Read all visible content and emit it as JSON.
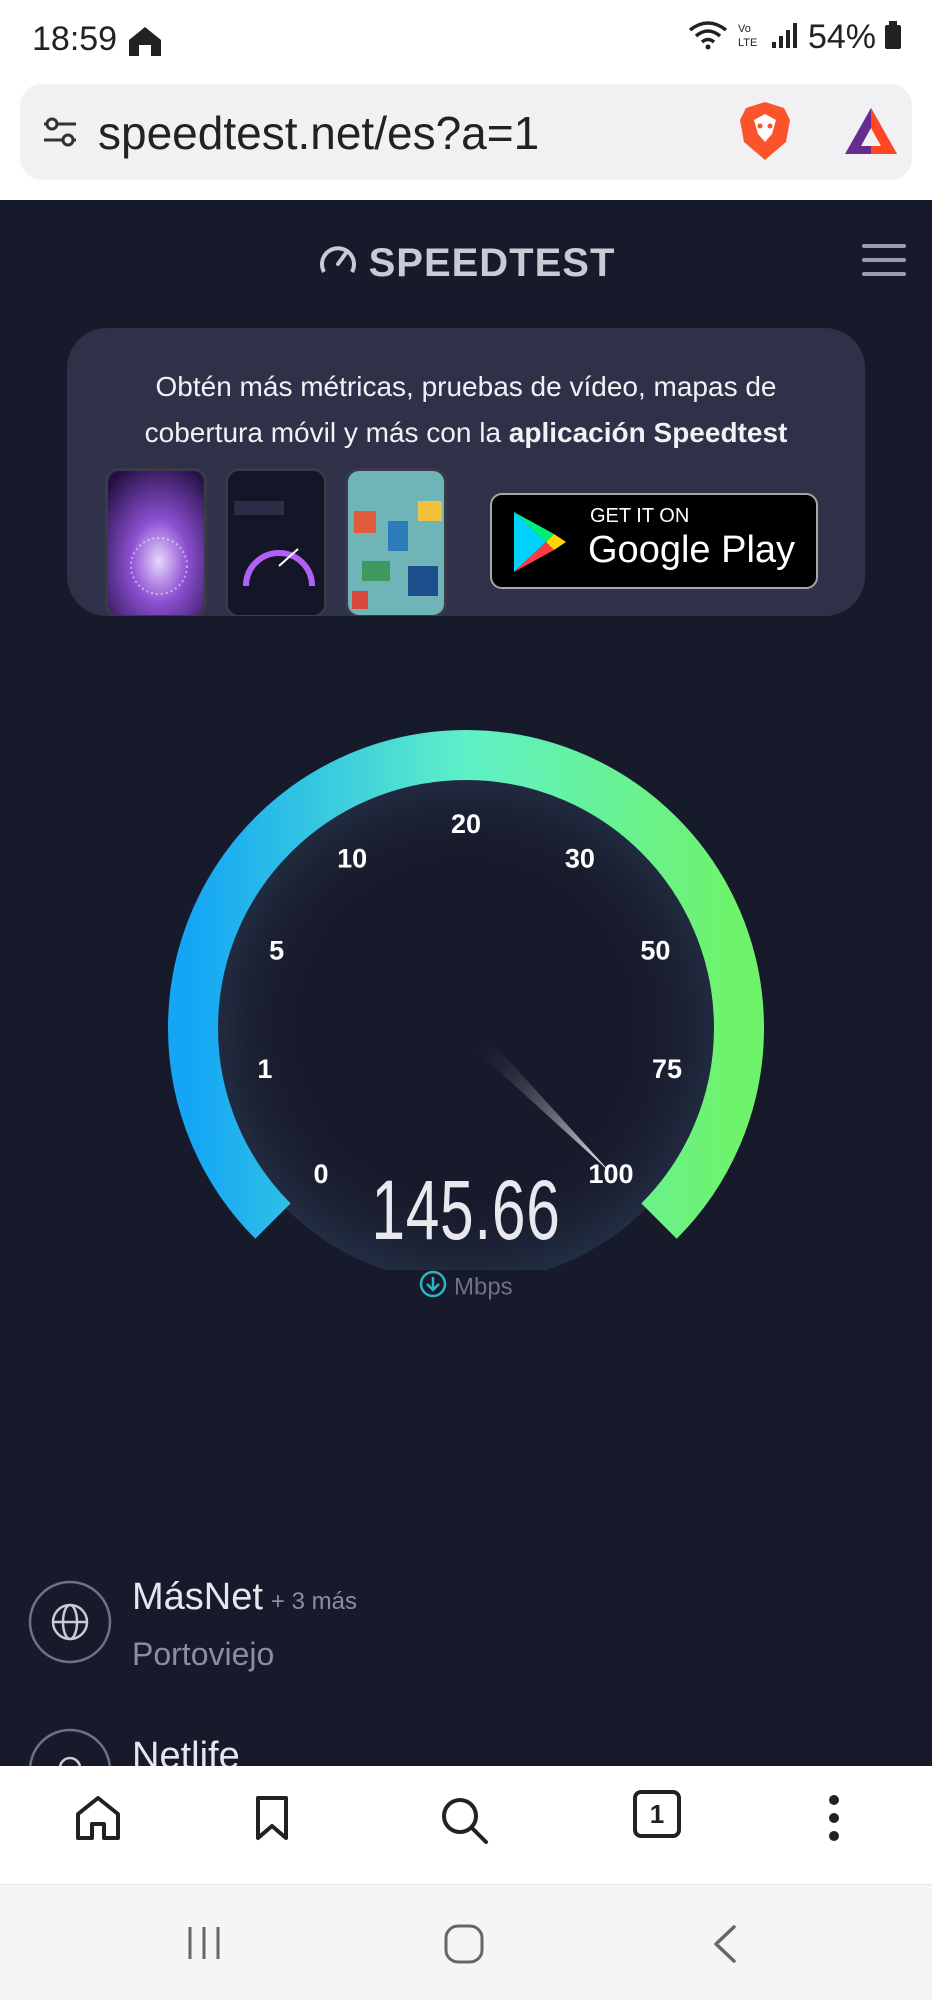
{
  "status_bar": {
    "time": "18:59",
    "battery_percent": "54%",
    "icons": [
      "home-icon",
      "wifi-icon",
      "volte-icon",
      "signal-icon",
      "battery-icon"
    ]
  },
  "browser": {
    "url": "speedtest.net/es?a=1",
    "icons": [
      "tune-icon",
      "brave-icon",
      "bat-rewards-icon"
    ]
  },
  "header": {
    "logo_text": "SPEEDTEST",
    "trademark": "®"
  },
  "promo": {
    "line1": "Obtén más métricas, pruebas de vídeo, mapas de",
    "line2_prefix": "cobertura móvil y más con la ",
    "line2_bold": "aplicación Speedtest",
    "store_small": "GET IT ON",
    "store_big": "Google Play"
  },
  "gauge": {
    "tick_labels": [
      "0",
      "1",
      "5",
      "10",
      "20",
      "30",
      "50",
      "75",
      "100"
    ],
    "needle_value": 100,
    "speed_value": "145.66",
    "unit": "Mbps",
    "colors": {
      "start": "#14a6f5",
      "mid": "#5ff0c8",
      "end": "#6ff36a",
      "background": "#171a2b"
    }
  },
  "servers": [
    {
      "name": "MásNet",
      "extra": "+ 3 más",
      "location": "Portoviejo"
    },
    {
      "name": "Netlife"
    }
  ],
  "toolbar": {
    "tab_count": "1",
    "icons": [
      "home-icon",
      "bookmark-icon",
      "search-icon",
      "tabs-icon",
      "more-icon"
    ]
  },
  "navbar": {
    "icons": [
      "recents-icon",
      "home-nav-icon",
      "back-icon"
    ]
  }
}
